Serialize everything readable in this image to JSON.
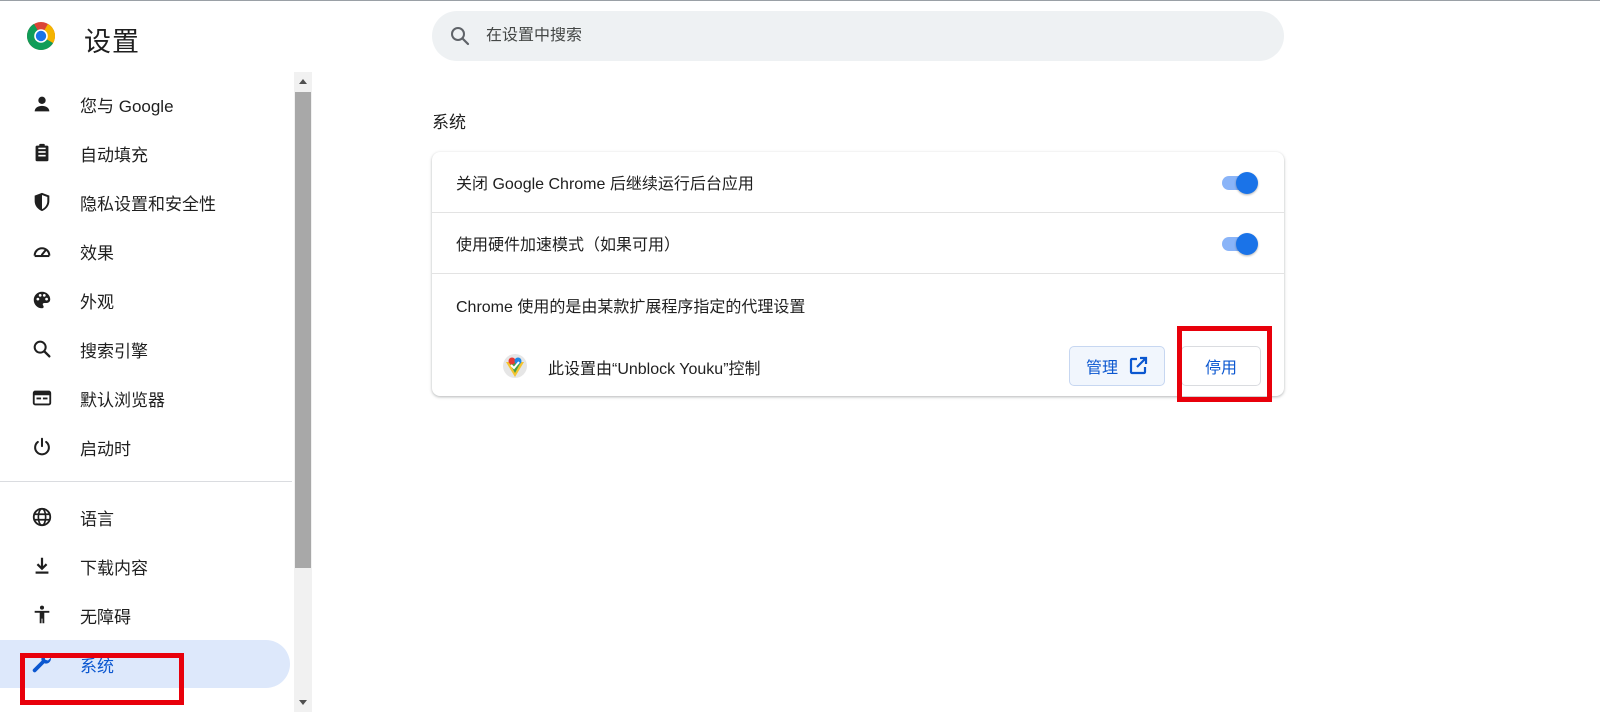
{
  "header": {
    "title": "设置",
    "search": {
      "placeholder": "在设置中搜索",
      "value": ""
    }
  },
  "sidebar": {
    "items": [
      {
        "label": "您与 Google",
        "icon": "person-icon"
      },
      {
        "label": "自动填充",
        "icon": "clipboard-icon"
      },
      {
        "label": "隐私设置和安全性",
        "icon": "shield-icon"
      },
      {
        "label": "效果",
        "icon": "speedometer-icon"
      },
      {
        "label": "外观",
        "icon": "palette-icon"
      },
      {
        "label": "搜索引擎",
        "icon": "search-icon"
      },
      {
        "label": "默认浏览器",
        "icon": "browser-window-icon"
      },
      {
        "label": "启动时",
        "icon": "power-icon"
      },
      {
        "label": "语言",
        "icon": "globe-icon"
      },
      {
        "label": "下载内容",
        "icon": "download-icon"
      },
      {
        "label": "无障碍",
        "icon": "accessibility-icon"
      },
      {
        "label": "系统",
        "icon": "wrench-icon",
        "active": true
      }
    ]
  },
  "main": {
    "section_title": "系统",
    "settings": {
      "background_apps": {
        "label": "关闭 Google Chrome 后继续运行后台应用",
        "enabled": true
      },
      "hardware_acceleration": {
        "label": "使用硬件加速模式（如果可用）",
        "enabled": true
      },
      "proxy": {
        "label": "Chrome 使用的是由某款扩展程序指定的代理设置",
        "extension_text": "此设置由“Unblock Youku”控制",
        "manage_label": "管理",
        "disable_label": "停用"
      }
    }
  },
  "colors": {
    "accent": "#0b57d0",
    "toggle_on": "#1a73e8",
    "highlight": "#e8000b",
    "active_nav_bg": "#dde8fb"
  }
}
